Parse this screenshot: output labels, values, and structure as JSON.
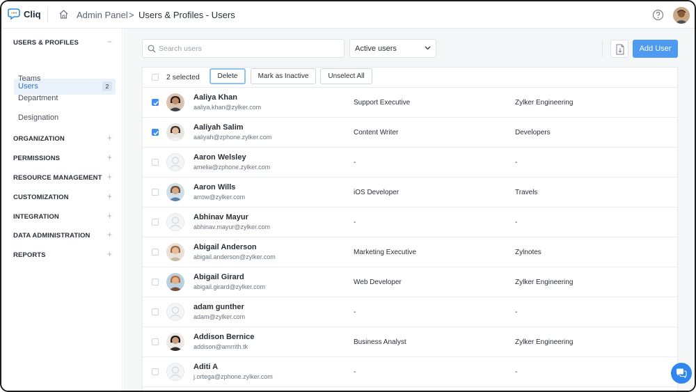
{
  "app": {
    "name": "Cliq"
  },
  "header": {
    "breadcrumb_root": "Admin Panel",
    "breadcrumb_sep": ">",
    "breadcrumb_page": "Users & Profiles - Users"
  },
  "sidebar": {
    "section_users": "USERS & PROFILES",
    "collapse_sign": "−",
    "expand_sign": "+",
    "items": [
      {
        "label": "Users",
        "badge": "2"
      },
      {
        "label": "Teams"
      },
      {
        "label": "Department"
      },
      {
        "label": "Designation"
      }
    ],
    "sections": [
      "ORGANIZATION",
      "PERMISSIONS",
      "RESOURCE MANAGEMENT",
      "CUSTOMIZATION",
      "INTEGRATION",
      "DATA ADMINISTRATION",
      "REPORTS"
    ]
  },
  "toolbar": {
    "search_placeholder": "Search users",
    "filter_value": "Active users",
    "add_user_label": "Add User"
  },
  "selection": {
    "count_label": "2 selected",
    "delete_label": "Delete",
    "mark_inactive_label": "Mark as Inactive",
    "unselect_all_label": "Unselect All"
  },
  "users": [
    {
      "name": "Aaliya Khan",
      "email": "aaliya.khan@zylker.com",
      "role": "Support Executive",
      "department": "Zylker Engineering",
      "checked": true,
      "avatar": "photo"
    },
    {
      "name": "Aaliyah Salim",
      "email": "aaliyah@zphone.zylker.com",
      "role": "Content Writer",
      "department": "Developers",
      "checked": true,
      "avatar": "photo"
    },
    {
      "name": "Aaron Welsley",
      "email": "amelia@zphone.zylker.com",
      "role": "-",
      "department": "-",
      "checked": false,
      "avatar": "placeholder"
    },
    {
      "name": "Aaron Wills",
      "email": "arrow@zylker.com",
      "role": "iOS Developer",
      "department": "Travels",
      "checked": false,
      "avatar": "photo"
    },
    {
      "name": "Abhinav Mayur",
      "email": "abhinav.mayur@zylker.com",
      "role": "-",
      "department": "-",
      "checked": false,
      "avatar": "placeholder"
    },
    {
      "name": "Abigail Anderson",
      "email": "abigail.anderson@zylker.com",
      "role": "Marketing Executive",
      "department": "Zylnotes",
      "checked": false,
      "avatar": "photo"
    },
    {
      "name": "Abigail Girard",
      "email": "abigail.girard@zylker.com",
      "role": "Web Developer",
      "department": "Zylker Engineering",
      "checked": false,
      "avatar": "photo"
    },
    {
      "name": "adam gunther",
      "email": "adam@zylker.com",
      "role": "-",
      "department": "-",
      "checked": false,
      "avatar": "placeholder"
    },
    {
      "name": "Addison Bernice",
      "email": "addison@amrrith.tk",
      "role": "Business Analyst",
      "department": "Zylker Engineering",
      "checked": false,
      "avatar": "photo"
    },
    {
      "name": "Aditi A",
      "email": "j.ortega@zphone.zylker.com",
      "role": "-",
      "department": "-",
      "checked": false,
      "avatar": "placeholder"
    }
  ],
  "colors": {
    "accent": "#4e9af1",
    "checkbox_checked": "#3d8ef0",
    "sidebar_active_bg": "#e9f1fb",
    "sidebar_active_text": "#2f73d6"
  }
}
